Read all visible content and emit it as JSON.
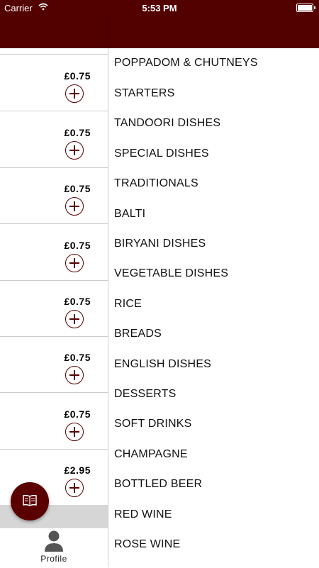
{
  "status_bar": {
    "carrier": "Carrier",
    "time": "5:53 PM"
  },
  "items": [
    {
      "price": "£0.75"
    },
    {
      "price": "£0.75"
    },
    {
      "price": "£0.75"
    },
    {
      "price": "£0.75"
    },
    {
      "price": "£0.75"
    },
    {
      "price": "£0.75"
    },
    {
      "price": "£0.75"
    },
    {
      "price": "£2.95"
    }
  ],
  "categories": [
    "POPPADOM & CHUTNEYS",
    "STARTERS",
    "TANDOORI DISHES",
    "SPECIAL DISHES",
    "TRADITIONALS",
    "BALTI",
    "BIRYANI DISHES",
    "VEGETABLE DISHES",
    "RICE",
    "BREADS",
    "ENGLISH DISHES",
    "DESSERTS",
    "SOFT DRINKS",
    "CHAMPAGNE",
    "BOTTLED BEER",
    "RED WINE",
    "ROSE WINE"
  ],
  "tab_bar": {
    "profile_label": "Profile"
  },
  "icons": {
    "fab": "menu-book-icon",
    "profile": "person-icon",
    "add": "plus-circle-icon",
    "wifi": "wifi-icon",
    "battery": "battery-icon"
  },
  "colors": {
    "brand": "#530000",
    "accent": "#5a0000",
    "grey_bar": "#d6d6d6"
  }
}
